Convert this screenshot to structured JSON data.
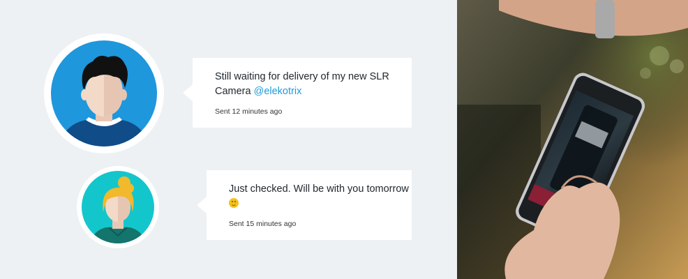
{
  "messages": [
    {
      "text": "Still waiting for delivery of my new SLR Camera",
      "mention": "@elekotrix",
      "time": "Sent 12 minutes ago"
    },
    {
      "text": "Just checked. Will be with you tomorrow",
      "emoji": "smile",
      "time": "Sent 15 minutes ago"
    }
  ],
  "colors": {
    "background": "#edf1f4",
    "avatar_blue": "#1e97dd",
    "avatar_teal": "#13c6cc",
    "mention": "#1f9bd9"
  },
  "icons": [
    "male-avatar-icon",
    "female-avatar-icon",
    "smile-emoji-icon"
  ],
  "photo_label": "hand holding smartphone scanning a bottle label"
}
